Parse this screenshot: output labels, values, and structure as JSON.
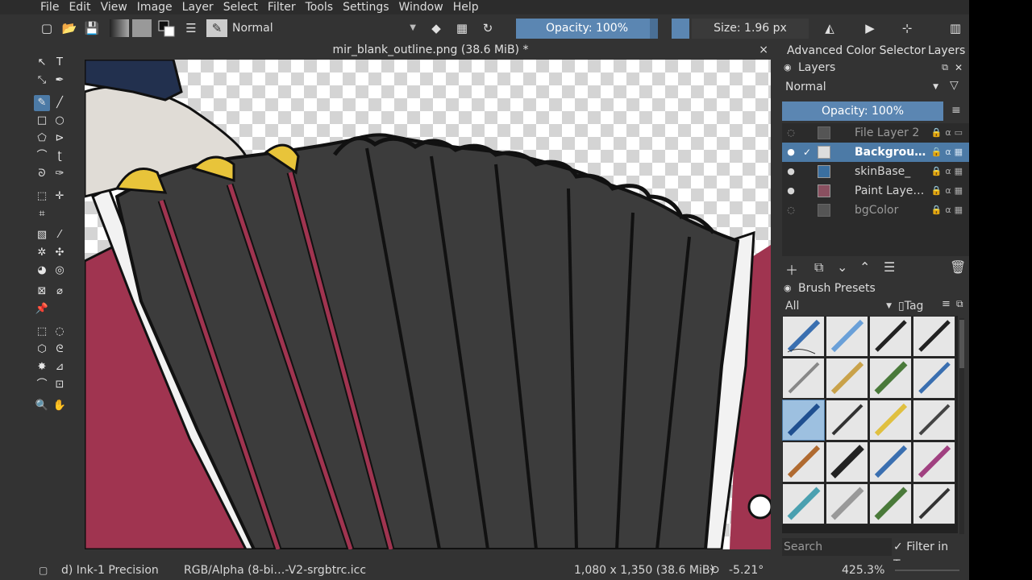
{
  "menu": [
    "File",
    "Edit",
    "View",
    "Image",
    "Layer",
    "Select",
    "Filter",
    "Tools",
    "Settings",
    "Window",
    "Help"
  ],
  "toolbar": {
    "blend_mode": "Normal",
    "opacity_label": "Opacity: 100%",
    "size_label": "Size: 1.96 px"
  },
  "document": {
    "tab_title": "mir_blank_outline.png (38.6 MiB) *",
    "close": "×"
  },
  "dock_tabs": [
    "Advanced Color Selector",
    "Layers"
  ],
  "layers": {
    "title": "Layers",
    "blend_mode": "Normal",
    "opacity_label": "Opacity:  100%",
    "items": [
      {
        "name": "File Layer 2",
        "visible": false,
        "selected": false
      },
      {
        "name": "Backgrou…",
        "visible": true,
        "selected": true
      },
      {
        "name": "skinBase_",
        "visible": true,
        "selected": false
      },
      {
        "name": "Paint Laye…",
        "visible": true,
        "selected": false
      },
      {
        "name": "bgColor",
        "visible": false,
        "selected": false
      }
    ]
  },
  "brush_presets": {
    "title": "Brush Presets",
    "filter": "All",
    "tag_label": "Tag",
    "search_placeholder": "Search",
    "filter_in_tag": "Filter in Tag"
  },
  "status": {
    "brush": "d) Ink-1 Precision",
    "color_profile": "RGB/Alpha (8-bi…-V2-srgbtrc.icc",
    "dimensions": "1,080 x 1,350 (38.6 MiB)",
    "rotation": "-5.21°",
    "zoom": "425.3%"
  },
  "colors": {
    "accent": "#5b86b2",
    "panel": "#333333",
    "crimson": "#a03450",
    "fur_gray": "#3c3c3c",
    "gold": "#e8c43a"
  }
}
